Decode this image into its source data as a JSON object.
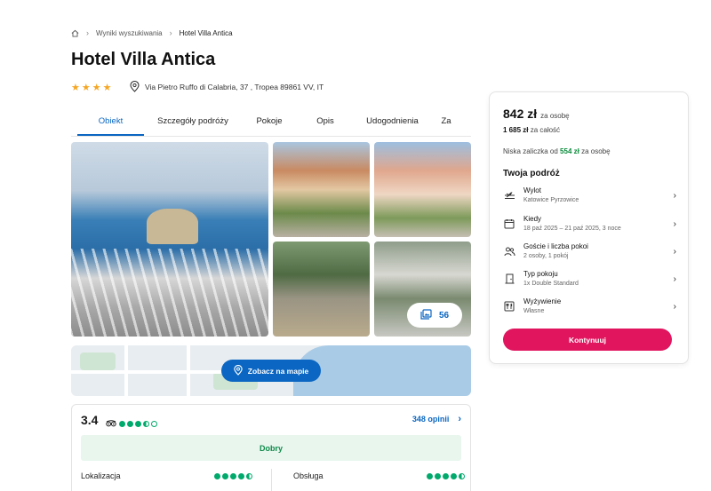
{
  "breadcrumb": {
    "home_icon": "home-icon",
    "items": [
      "Wyniki wyszukiwania",
      "Hotel Villa Antica"
    ]
  },
  "hotel": {
    "name": "Hotel Villa Antica",
    "stars": 4,
    "address": "Via Pietro Ruffo di Calabria, 37 , Tropea 89861 VV, IT"
  },
  "tabs": [
    {
      "label": "Obiekt",
      "active": true
    },
    {
      "label": "Szczegóły podróży",
      "active": false
    },
    {
      "label": "Pokoje",
      "active": false
    },
    {
      "label": "Opis",
      "active": false
    },
    {
      "label": "Udogodnienia",
      "active": false
    },
    {
      "label": "Za",
      "active": false
    }
  ],
  "gallery": {
    "photo_count": "56",
    "photo_icon": "gallery-icon"
  },
  "map": {
    "button_label": "Zobacz na mapie",
    "button_icon": "location-pin-icon"
  },
  "reviews": {
    "score": "3.4",
    "provider_icon": "tripadvisor-icon",
    "rating_dots": 3.5,
    "count_label": "348 opinii",
    "verdict": "Dobry",
    "categories": [
      {
        "label": "Lokalizacja",
        "dots": 4.5
      },
      {
        "label": "Obsługa",
        "dots": 4.5
      }
    ]
  },
  "booking": {
    "price": "842 zł",
    "price_unit": "za osobę",
    "total_amount": "1 685 zł",
    "total_unit": "za całość",
    "deposit_prefix": "Niska zaliczka od",
    "deposit_amount": "554 zł",
    "deposit_suffix": "za osobę",
    "trip_title": "Twoja podróż",
    "trip_items": [
      {
        "label": "Wylot",
        "value": "Katowice Pyrzowice",
        "icon": "plane-icon"
      },
      {
        "label": "Kiedy",
        "value": "18 paź 2025 – 21 paź 2025, 3 noce",
        "icon": "calendar-icon"
      },
      {
        "label": "Goście i liczba pokoi",
        "value": "2 osoby, 1 pokój",
        "icon": "guests-icon"
      },
      {
        "label": "Typ pokoju",
        "value": "1x Double Standard",
        "icon": "door-icon"
      },
      {
        "label": "Wyżywienie",
        "value": "Własne",
        "icon": "cutlery-icon"
      }
    ],
    "cta_label": "Kontynuuj"
  },
  "colors": {
    "accent": "#0a66c2",
    "cta": "#e0155e",
    "star": "#f5a623",
    "tripadvisor": "#00aa6c",
    "verdict_bg": "#e8f6ee"
  }
}
